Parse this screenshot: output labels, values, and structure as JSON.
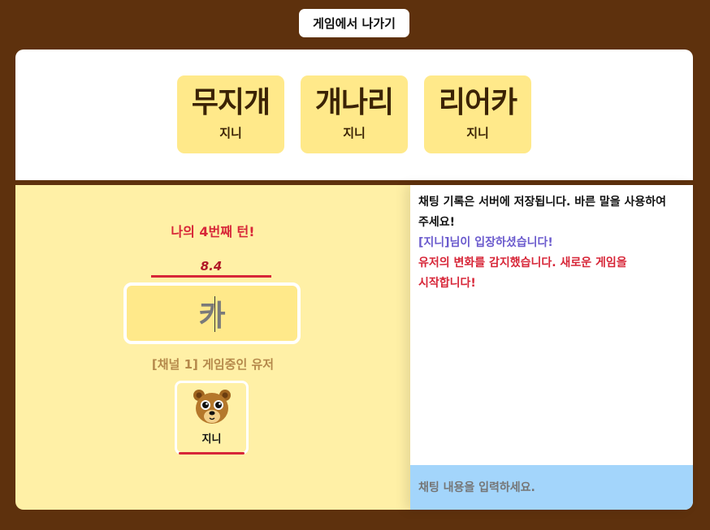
{
  "header": {
    "exit_label": "게임에서 나가기"
  },
  "words": [
    {
      "word": "무지개",
      "player": "지니"
    },
    {
      "word": "개나리",
      "player": "지니"
    },
    {
      "word": "리어카",
      "player": "지니"
    }
  ],
  "game": {
    "turn_text": "나의 4번째 턴!",
    "timer": "8.4",
    "input_value": "카",
    "channel_text": "[채널 1] 게임중인 유저",
    "user": {
      "name": "지니",
      "avatar_icon": "bear-icon"
    }
  },
  "chat": {
    "messages": [
      {
        "text": "채팅 기록은 서버에 저장됩니다. 바른 말을 사용하여 주세요!",
        "type": "system"
      },
      {
        "text": "[지니]님이 입장하셨습니다!",
        "type": "join"
      },
      {
        "text": "유저의 변화를 감지했습니다. 새로운 게임을 시작합니다!",
        "type": "alert"
      }
    ],
    "input_placeholder": "채팅 내용을 입력하세요."
  },
  "colors": {
    "background": "#5e310d",
    "card": "#ffe98a",
    "game_panel": "#fff0a6",
    "accent_red": "#d72638",
    "chat_input": "#a3d5fb",
    "join_message": "#6a5acd"
  }
}
